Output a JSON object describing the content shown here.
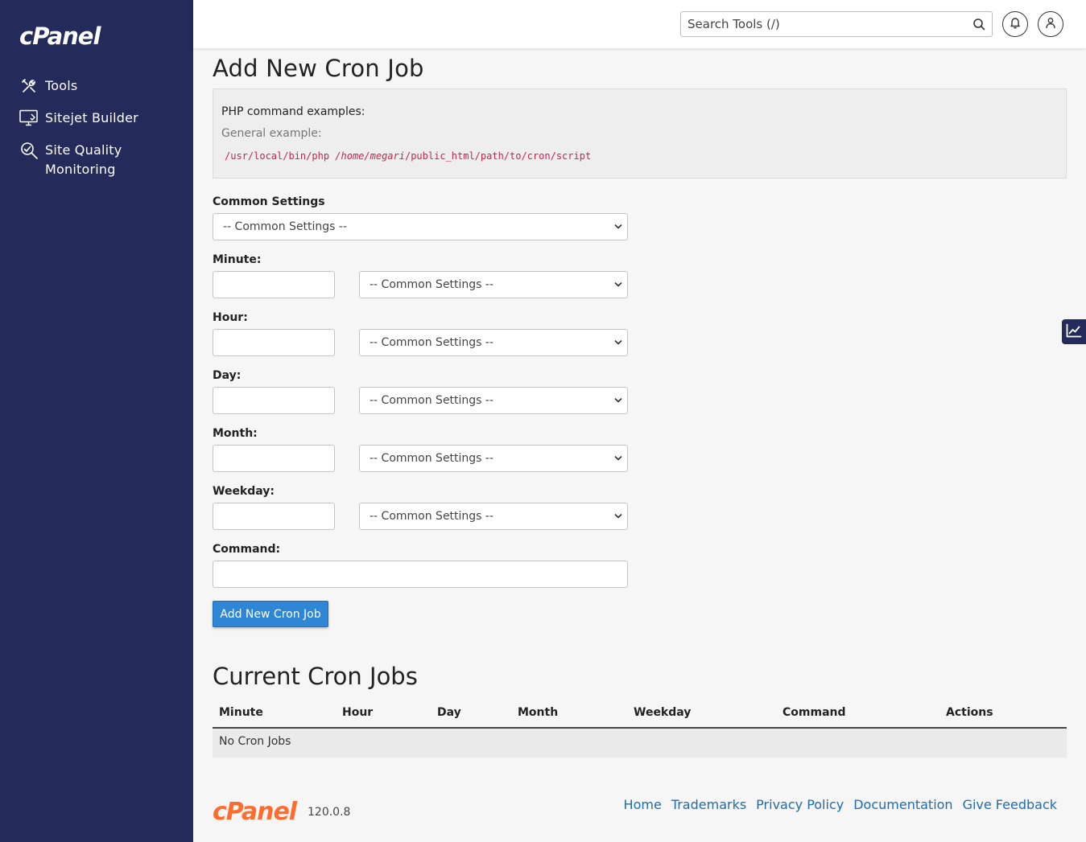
{
  "brand": {
    "logo_text": "cPanel",
    "version": "120.0.8"
  },
  "sidebar": {
    "items": [
      {
        "label": "Tools",
        "icon": "tools-icon"
      },
      {
        "label": "Sitejet Builder",
        "icon": "sitejet-icon"
      },
      {
        "label": "Site Quality",
        "label2": "Monitoring",
        "icon": "site-quality-icon"
      }
    ]
  },
  "header": {
    "search_placeholder": "Search Tools (/)",
    "icons": [
      "search-icon",
      "bell-icon",
      "user-icon"
    ]
  },
  "page": {
    "title": "Add New Cron Job",
    "examples": {
      "title": "PHP command examples:",
      "general_label": "General example:",
      "code_prefix": "/usr/local/bin/php ",
      "code_italic": "/home/megari",
      "code_suffix": "/public_html/path/to/cron/script"
    },
    "common_settings_label": "Common Settings",
    "common_settings_value": "-- Common Settings --",
    "fields": [
      {
        "label": "Minute:",
        "value": "",
        "select": "-- Common Settings --"
      },
      {
        "label": "Hour:",
        "value": "",
        "select": "-- Common Settings --"
      },
      {
        "label": "Day:",
        "value": "",
        "select": "-- Common Settings --"
      },
      {
        "label": "Month:",
        "value": "",
        "select": "-- Common Settings --"
      },
      {
        "label": "Weekday:",
        "value": "",
        "select": "-- Common Settings --"
      }
    ],
    "command_label": "Command:",
    "command_value": "",
    "submit_label": "Add New Cron Job"
  },
  "current": {
    "title": "Current Cron Jobs",
    "columns": [
      "Minute",
      "Hour",
      "Day",
      "Month",
      "Weekday",
      "Command",
      "Actions"
    ],
    "empty_text": "No Cron Jobs"
  },
  "footer": {
    "links": [
      "Home",
      "Trademarks",
      "Privacy Policy",
      "Documentation",
      "Give Feedback"
    ]
  },
  "colors": {
    "sidebar_bg": "#242a5a",
    "primary": "#2e86d4",
    "brand_orange": "#ff6c2c",
    "code_red": "#c7254e",
    "link": "#1f6cb0"
  }
}
